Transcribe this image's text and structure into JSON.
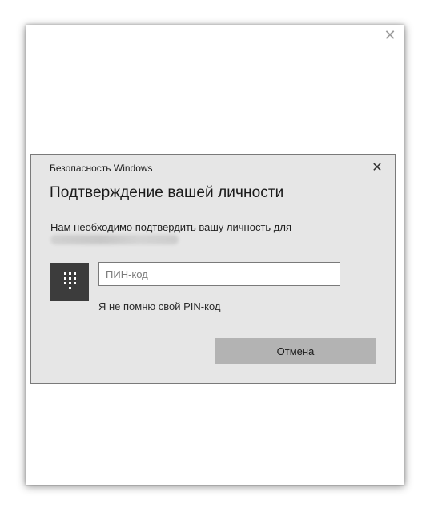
{
  "outer_window": {
    "close_glyph": "✕"
  },
  "dialog": {
    "app_title": "Безопасность Windows",
    "close_glyph": "✕",
    "heading": "Подтверждение вашей личности",
    "message": "Нам необходимо подтвердить вашу личность для",
    "pin_input": {
      "value": "",
      "placeholder": "ПИН-код"
    },
    "forgot_pin_link": "Я не помню свой PIN-код",
    "cancel_label": "Отмена"
  },
  "icons": {
    "outer_close": "close-icon",
    "dialog_close": "close-icon",
    "pin_keypad": "keypad-icon"
  },
  "colors": {
    "dialog_background": "#e6e6e6",
    "pin_tile": "#3c3c3c",
    "cancel_button": "#b3b3b3"
  }
}
